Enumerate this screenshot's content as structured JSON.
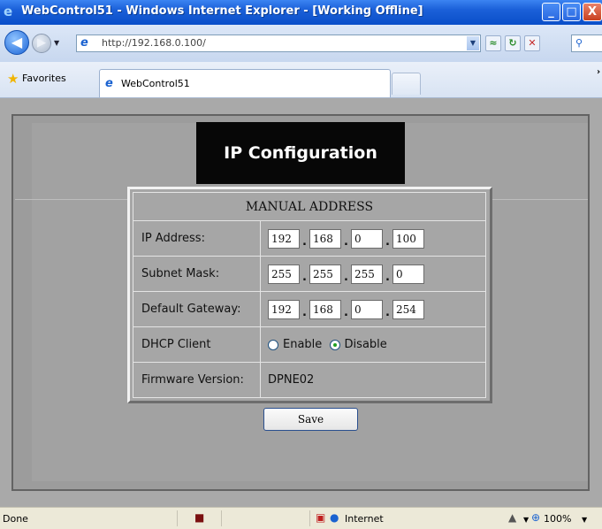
{
  "window": {
    "title": "WebControl51 - Windows Internet Explorer - [Working Offline]",
    "minimize_glyph": "_",
    "maximize_glyph": "□",
    "close_glyph": "X"
  },
  "navigation": {
    "address": "http://192.168.0.100/"
  },
  "favorites": {
    "label": "Favorites"
  },
  "tab": {
    "label": "WebControl51"
  },
  "page": {
    "header": "IP Configuration",
    "section_title": "MANUAL ADDRESS",
    "ip_address": {
      "label": "IP Address:",
      "octets": [
        "192",
        "168",
        "0",
        "100"
      ]
    },
    "subnet_mask": {
      "label": "Subnet Mask:",
      "octets": [
        "255",
        "255",
        "255",
        "0"
      ]
    },
    "default_gateway": {
      "label": "Default Gateway:",
      "octets": [
        "192",
        "168",
        "0",
        "254"
      ]
    },
    "octet_separator": ".",
    "dhcp": {
      "label": "DHCP Client",
      "enable_label": "Enable",
      "disable_label": "Disable",
      "selected": "Disable"
    },
    "firmware": {
      "label": "Firmware Version:",
      "value": "DPNE02"
    },
    "save_label": "Save"
  },
  "status": {
    "text": "Done",
    "zone": "Internet",
    "zoom": "100%"
  },
  "icons": [
    "ie-logo-icon",
    "back-icon",
    "forward-icon",
    "page-icon",
    "compatibility-icon",
    "refresh-icon",
    "stop-icon",
    "search-icon",
    "favorites-star-icon",
    "tab-page-icon",
    "network-offline-icon",
    "protected-mode-icon",
    "globe-icon",
    "security-icon",
    "zoom-icon"
  ],
  "colors": {
    "titlebar": "#0a4fc9",
    "page_bg": "#a9a9a9",
    "header_bg": "#070707",
    "header_text": "#ffffff"
  }
}
